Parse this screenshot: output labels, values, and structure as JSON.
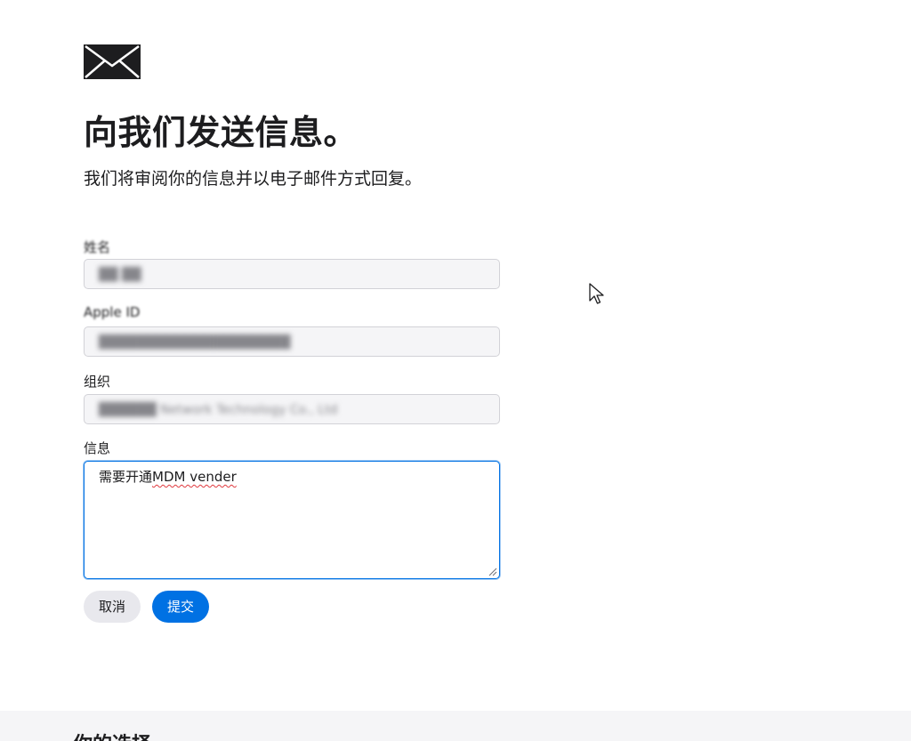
{
  "header": {
    "icon": "mail-icon",
    "title": "向我们发送信息。",
    "subtitle": "我们将审阅你的信息并以电子邮件方式回复。"
  },
  "form": {
    "name": {
      "label": "姓名",
      "value": "██ ██"
    },
    "apple_id": {
      "label": "Apple ID",
      "value": "████████████████████"
    },
    "organization": {
      "label": "组织",
      "value": "██████ Network Technology Co., Ltd"
    },
    "message": {
      "label": "信息",
      "value_prefix": "需要开通",
      "value_misspelled": "MDM vender"
    }
  },
  "buttons": {
    "cancel": "取消",
    "submit": "提交"
  },
  "footer": {
    "title": "你的选择"
  },
  "colors": {
    "accent": "#0071e3",
    "text": "#1d1d1f",
    "field_bg": "#f5f5f7"
  }
}
